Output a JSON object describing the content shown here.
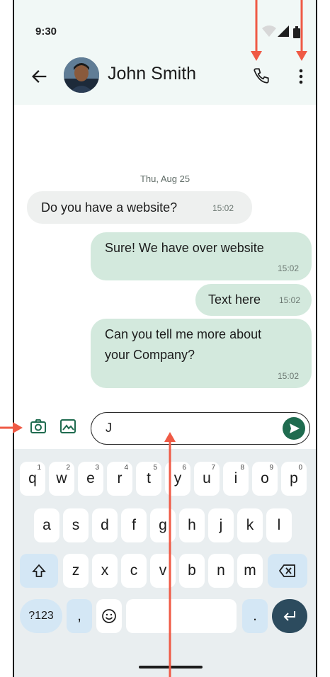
{
  "status_bar": {
    "time": "9:30"
  },
  "app_bar": {
    "contact_name": "John Smith"
  },
  "conversation": {
    "date": "Thu, Aug 25",
    "messages": [
      {
        "direction": "incoming",
        "text": "Do you have a website?",
        "time": "15:02"
      },
      {
        "direction": "outgoing",
        "text": "Sure! We have over website",
        "time": "15:02"
      },
      {
        "direction": "outgoing",
        "text": "Text here",
        "time": "15:02"
      },
      {
        "direction": "outgoing",
        "text_line1": "Can you tell me more about",
        "text_line2": "your Company?",
        "time": "15:02"
      }
    ]
  },
  "composer": {
    "value": "J"
  },
  "keyboard": {
    "row1": [
      {
        "key": "q",
        "hint": "1"
      },
      {
        "key": "w",
        "hint": "2"
      },
      {
        "key": "e",
        "hint": "3"
      },
      {
        "key": "r",
        "hint": "4"
      },
      {
        "key": "t",
        "hint": "5"
      },
      {
        "key": "y",
        "hint": "6"
      },
      {
        "key": "u",
        "hint": "7"
      },
      {
        "key": "i",
        "hint": "8"
      },
      {
        "key": "o",
        "hint": "9"
      },
      {
        "key": "p",
        "hint": "0"
      }
    ],
    "row2": [
      "a",
      "s",
      "d",
      "f",
      "g",
      "h",
      "j",
      "k",
      "l"
    ],
    "row3": [
      "z",
      "x",
      "c",
      "v",
      "b",
      "n",
      "m"
    ],
    "row4": {
      "symbols": "?123",
      "comma": ",",
      "period": "."
    }
  },
  "colors": {
    "accent": "#1f6b4f",
    "outgoing_bubble": "#d3e9dd",
    "incoming_bubble": "#eef0ef",
    "annotation_arrow": "#ef5a45"
  },
  "icons": [
    "back-arrow-icon",
    "phone-icon",
    "more-vert-icon",
    "camera-icon",
    "image-icon",
    "send-icon",
    "shift-icon",
    "backspace-icon",
    "emoji-icon",
    "enter-icon",
    "wifi-icon",
    "signal-icon",
    "battery-icon"
  ]
}
